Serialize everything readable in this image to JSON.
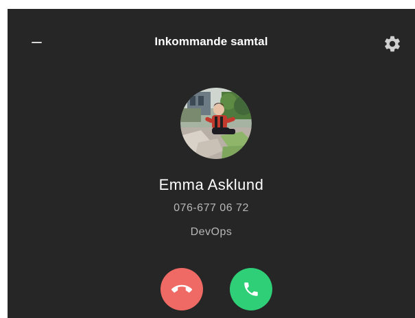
{
  "window": {
    "title": "Inkommande samtal",
    "minimize_icon": "minus-icon",
    "settings_icon": "gear-icon"
  },
  "caller": {
    "name": "Emma Asklund",
    "phone": "076-677 06 72",
    "department": "DevOps",
    "avatar_icon": "caller-photo"
  },
  "actions": {
    "decline_icon": "phone-hangup-icon",
    "accept_icon": "phone-icon"
  },
  "colors": {
    "background": "#262626",
    "decline": "#ef6a64",
    "accept": "#2fcf78",
    "secondary_text": "#b8b8b8"
  }
}
